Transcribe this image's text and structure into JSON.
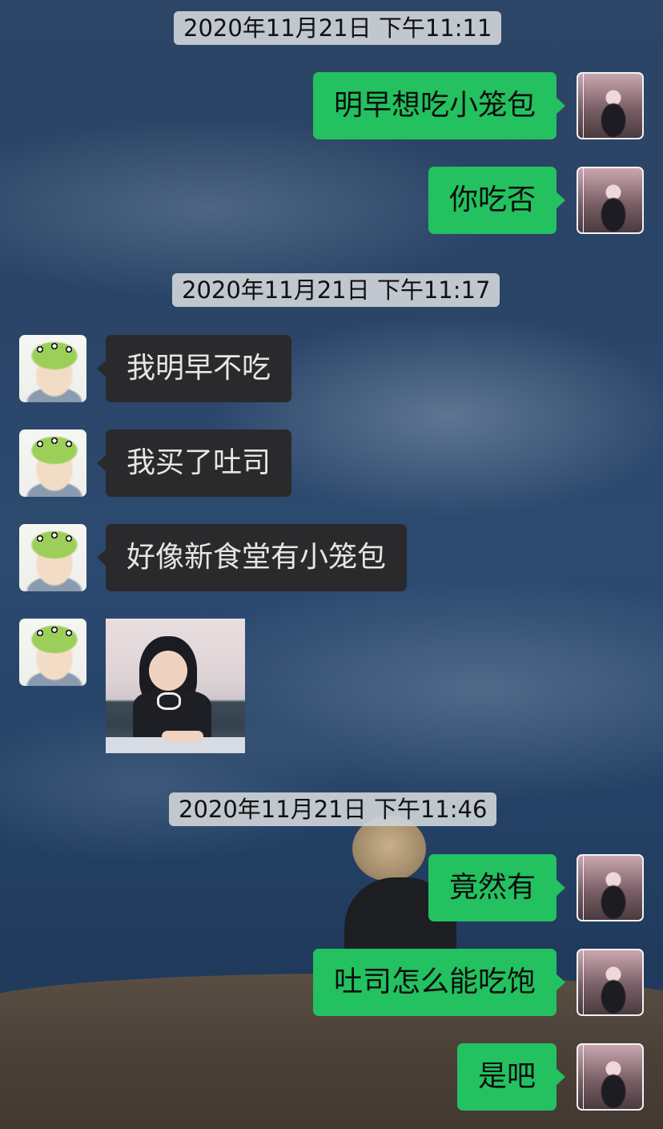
{
  "chat": {
    "timestamps": [
      "2020年11月21日 下午11:11",
      "2020年11月21日 下午11:17",
      "2020年11月21日 下午11:46"
    ],
    "messages": [
      {
        "sender": "self",
        "text": "明早想吃小笼包"
      },
      {
        "sender": "self",
        "text": "你吃否"
      },
      {
        "sender": "other",
        "text": "我明早不吃"
      },
      {
        "sender": "other",
        "text": "我买了吐司"
      },
      {
        "sender": "other",
        "text": "好像新食堂有小笼包"
      },
      {
        "sender": "other",
        "type": "sticker",
        "text": ""
      },
      {
        "sender": "self",
        "text": "竟然有"
      },
      {
        "sender": "self",
        "text": "吐司怎么能吃饱"
      },
      {
        "sender": "self",
        "text": "是吧"
      }
    ]
  },
  "colors": {
    "self_bubble": "#23c15f",
    "other_bubble": "#2a2a2c",
    "timestamp_bg": "#cdd2d7"
  }
}
